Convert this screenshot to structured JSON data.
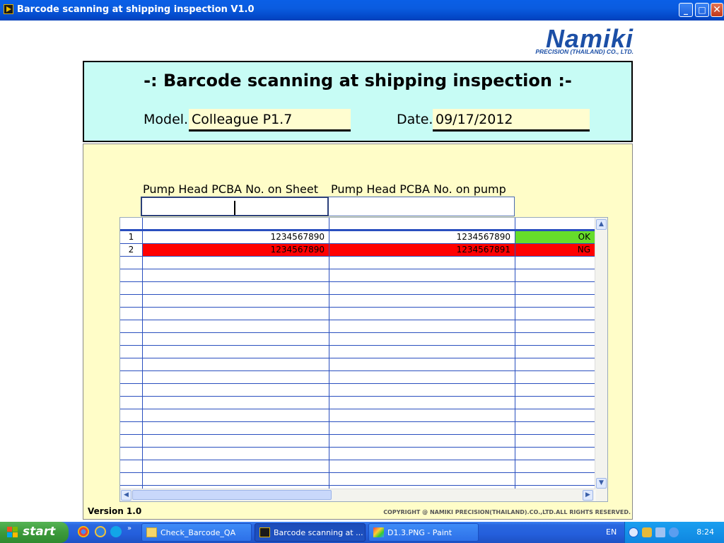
{
  "window": {
    "title": "Barcode scanning at shipping inspection V1.0"
  },
  "logo": {
    "name": "Namiki",
    "subtitle": "PRECISION (THAILAND) CO., LTD."
  },
  "header": {
    "title": "-: Barcode scanning at shipping inspection :-",
    "model_label": "Model.",
    "model_value": "Colleague P1.7",
    "date_label": "Date.",
    "date_value": "09/17/2012"
  },
  "inputs": {
    "sheet_header": "Pump Head PCBA No. on Sheet",
    "pump_header": "Pump Head PCBA No. on pump",
    "sheet_value": "",
    "pump_value": ""
  },
  "table": {
    "rows": [
      {
        "no": "1",
        "sheet": "1234567890",
        "pump": "1234567890",
        "result": "OK"
      },
      {
        "no": "2",
        "sheet": "1234567890",
        "pump": "1234567891",
        "result": "NG"
      }
    ],
    "colors": {
      "ok": "#66dd2a",
      "ng": "#ff0000",
      "grid": "#2a4fbf"
    }
  },
  "footer": {
    "version": "Version 1.0",
    "copyright": "COPYRIGHT @  NAMIKI PRECISION(THAILAND).CO.,LTD.ALL RIGHTS RESERVED."
  },
  "taskbar": {
    "start": "start",
    "quick_launch": [
      "chrome-icon",
      "ie-icon",
      "skype-icon"
    ],
    "tasks": [
      {
        "label": "Check_Barcode_QA",
        "icon": "folder-icon",
        "active": false
      },
      {
        "label": "Barcode scanning at ...",
        "icon": "labview-icon",
        "active": true
      },
      {
        "label": "D1.3.PNG - Paint",
        "icon": "paint-icon",
        "active": false
      }
    ],
    "language": "EN",
    "clock": "8:24"
  }
}
